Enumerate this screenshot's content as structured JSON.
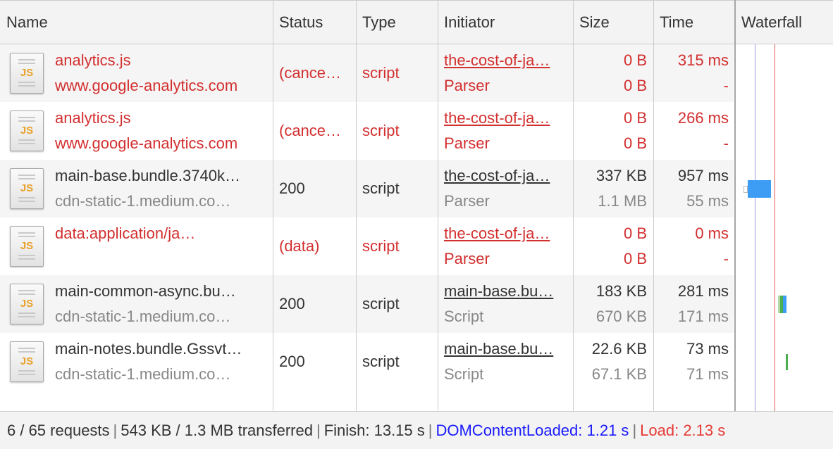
{
  "columns": {
    "name": "Name",
    "status": "Status",
    "type": "Type",
    "initiator": "Initiator",
    "size": "Size",
    "time": "Time",
    "waterfall": "Waterfall"
  },
  "rows": [
    {
      "name": "analytics.js",
      "domain": "www.google-analytics.com",
      "status": "(cance…",
      "type": "script",
      "initiator": "the-cost-of-ja…",
      "initiator_sub": "Parser",
      "size": "0 B",
      "size_sub": "0 B",
      "time": "315 ms",
      "time_sub": "-",
      "icon": "js-file-icon",
      "failed": true
    },
    {
      "name": "analytics.js",
      "domain": "www.google-analytics.com",
      "status": "(cance…",
      "type": "script",
      "initiator": "the-cost-of-ja…",
      "initiator_sub": "Parser",
      "size": "0 B",
      "size_sub": "0 B",
      "time": "266 ms",
      "time_sub": "-",
      "icon": "js-file-icon",
      "failed": true
    },
    {
      "name": "main-base.bundle.3740k…",
      "domain": "cdn-static-1.medium.co…",
      "status": "200",
      "type": "script",
      "initiator": "the-cost-of-ja…",
      "initiator_sub": "Parser",
      "size": "337 KB",
      "size_sub": "1.1 MB",
      "time": "957 ms",
      "time_sub": "55 ms",
      "icon": "js-file-icon",
      "failed": false
    },
    {
      "name": "data:application/ja…",
      "domain": "",
      "status": "(data)",
      "type": "script",
      "initiator": "the-cost-of-ja…",
      "initiator_sub": "Parser",
      "size": "0 B",
      "size_sub": "0 B",
      "time": "0 ms",
      "time_sub": "-",
      "icon": "js-file-icon",
      "failed": true
    },
    {
      "name": "main-common-async.bu…",
      "domain": "cdn-static-1.medium.co…",
      "status": "200",
      "type": "script",
      "initiator": "main-base.bu…",
      "initiator_sub": "Script",
      "size": "183 KB",
      "size_sub": "670 KB",
      "time": "281 ms",
      "time_sub": "171 ms",
      "icon": "js-file-icon",
      "failed": false
    },
    {
      "name": "main-notes.bundle.Gssvt…",
      "domain": "cdn-static-1.medium.co…",
      "status": "200",
      "type": "script",
      "initiator": "main-base.bu…",
      "initiator_sub": "Script",
      "size": "22.6 KB",
      "size_sub": "67.1 KB",
      "time": "73 ms",
      "time_sub": "71 ms",
      "icon": "js-file-icon",
      "failed": false
    }
  ],
  "footer": {
    "requests": "6 / 65 requests",
    "transferred": "543 KB / 1.3 MB transferred",
    "finish": "Finish: 13.15 s",
    "dom_content_loaded": "DOMContentLoaded: 1.21 s",
    "load": "Load: 2.13 s",
    "separator": "|"
  },
  "colors": {
    "error_red": "#d32f2f",
    "dom_content_loaded_blue": "#1a1aff",
    "load_red": "#e53935",
    "bar_blue": "#3d9df5",
    "bar_green": "#4caf50"
  }
}
